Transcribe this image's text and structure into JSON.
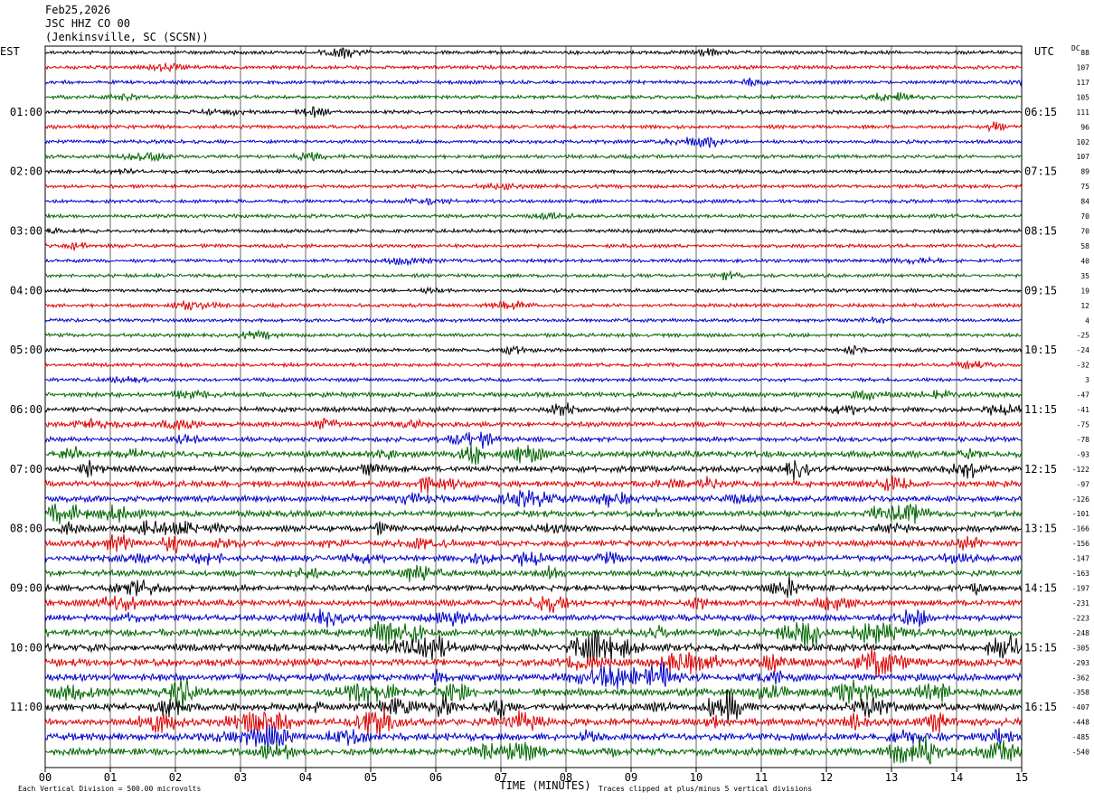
{
  "header": {
    "date": "Feb25,2026",
    "station": "JSC HHZ CO 00",
    "location": "(Jenkinsville, SC (SCSN))"
  },
  "axes": {
    "left_tz": "EST",
    "right_tz": "UTC",
    "dc_label": "DC"
  },
  "footer": {
    "scale": "Each Vertical Division =  500.00 microvolts",
    "xlabel": "TIME (MINUTES)",
    "clip_note": "Traces clipped at plus/minus 5 vertical divisions"
  },
  "chart_data": {
    "type": "line",
    "title": "",
    "xlabel": "TIME (MINUTES)",
    "xlim": [
      0,
      15
    ],
    "x_ticks": [
      "00",
      "01",
      "02",
      "03",
      "04",
      "05",
      "06",
      "07",
      "08",
      "09",
      "10",
      "11",
      "12",
      "13",
      "14",
      "15"
    ],
    "row_minutes": 15,
    "trace_colors": [
      "#000000",
      "#dd0000",
      "#0000cc",
      "#006600"
    ],
    "left_hour_labels": [
      {
        "row": 4,
        "label": "01:00"
      },
      {
        "row": 8,
        "label": "02:00"
      },
      {
        "row": 12,
        "label": "03:00"
      },
      {
        "row": 16,
        "label": "04:00"
      },
      {
        "row": 20,
        "label": "05:00"
      },
      {
        "row": 24,
        "label": "06:00"
      },
      {
        "row": 28,
        "label": "07:00"
      },
      {
        "row": 32,
        "label": "08:00"
      },
      {
        "row": 36,
        "label": "09:00"
      },
      {
        "row": 40,
        "label": "10:00"
      },
      {
        "row": 44,
        "label": "11:00"
      }
    ],
    "right_hour_labels": [
      {
        "row": 4,
        "label": "06:15"
      },
      {
        "row": 8,
        "label": "07:15"
      },
      {
        "row": 12,
        "label": "08:15"
      },
      {
        "row": 16,
        "label": "09:15"
      },
      {
        "row": 20,
        "label": "10:15"
      },
      {
        "row": 24,
        "label": "11:15"
      },
      {
        "row": 28,
        "label": "12:15"
      },
      {
        "row": 32,
        "label": "13:15"
      },
      {
        "row": 36,
        "label": "14:15"
      },
      {
        "row": 40,
        "label": "15:15"
      },
      {
        "row": 44,
        "label": "16:15"
      }
    ],
    "dc_offsets": [
      "88",
      "107",
      "117",
      "105",
      "111",
      "96",
      "102",
      "107",
      "89",
      "75",
      "84",
      "70",
      "70",
      "58",
      "40",
      "35",
      "19",
      "12",
      "4",
      "-25",
      "-24",
      "-32",
      "3",
      "-47",
      "-41",
      "-75",
      "-78",
      "-93",
      "-122",
      "-97",
      "-126",
      "-101",
      "-166",
      "-156",
      "-147",
      "-163",
      "-197",
      "-231",
      "-223",
      "-248",
      "-305",
      "-293",
      "-362",
      "-358",
      "-407",
      "-448",
      "-485",
      "-540"
    ],
    "trace_activity": [
      1,
      1,
      1,
      1,
      1,
      1,
      1,
      1,
      1,
      1,
      1,
      1,
      1,
      1,
      1,
      1,
      1,
      1,
      1,
      1,
      1,
      1,
      1,
      2,
      2,
      2,
      2,
      3,
      3,
      3,
      3,
      3,
      3,
      3,
      3,
      3,
      3,
      3,
      3,
      4,
      4,
      4,
      4,
      4,
      4,
      4,
      4,
      4
    ]
  }
}
